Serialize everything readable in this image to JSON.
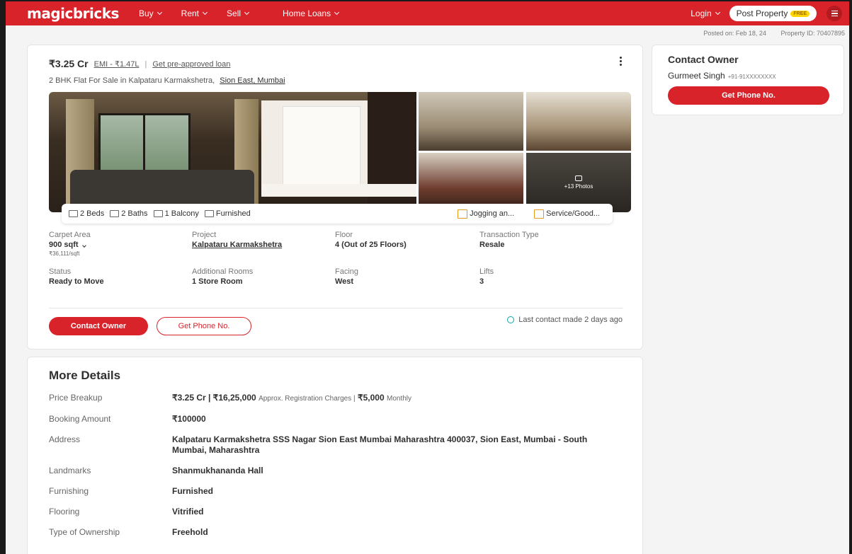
{
  "nav": {
    "logo": "magicbricks",
    "items": [
      "Buy",
      "Rent",
      "Sell",
      "Home Loans"
    ],
    "login": "Login",
    "post_property": "Post Property",
    "free_badge": "FREE"
  },
  "meta": {
    "posted_on": "Posted on: Feb 18, 24",
    "property_id": "Property ID: 70407895"
  },
  "listing": {
    "price": "₹3.25 Cr",
    "emi": "EMI - ₹1.47L",
    "separator": "|",
    "loan_link": "Get pre-approved loan",
    "subtitle": "2 BHK Flat For Sale in Kalpataru Karmakshetra,",
    "location_link": "Sion East, Mumbai",
    "more_photos": "+13 Photos",
    "amenities": [
      {
        "label": "2 Beds",
        "icon": "bed-icon"
      },
      {
        "label": "2 Baths",
        "icon": "bath-icon"
      },
      {
        "label": "1 Balcony",
        "icon": "balcony-icon"
      },
      {
        "label": "Furnished",
        "icon": "furnished-icon"
      }
    ],
    "features": [
      {
        "label": "Jogging an...",
        "icon": "jogging-icon"
      },
      {
        "label": "Service/Good...",
        "icon": "service-lift-icon"
      }
    ],
    "specs": {
      "carpet_area": {
        "label": "Carpet Area",
        "value": "900 sqft",
        "sub": "₹36,111/sqft"
      },
      "project": {
        "label": "Project",
        "value": "Kalpataru Karmakshetra"
      },
      "floor": {
        "label": "Floor",
        "value": "4 (Out of 25 Floors)"
      },
      "transaction": {
        "label": "Transaction Type",
        "value": "Resale"
      },
      "status": {
        "label": "Status",
        "value": "Ready to Move"
      },
      "rooms": {
        "label": "Additional Rooms",
        "value": "1 Store Room"
      },
      "facing": {
        "label": "Facing",
        "value": "West"
      },
      "lifts": {
        "label": "Lifts",
        "value": "3"
      }
    },
    "contact_owner_button": "Contact Owner",
    "get_phone_button": "Get Phone No.",
    "last_contact": "Last contact made 2 days ago"
  },
  "owner": {
    "title": "Contact Owner",
    "name": "Gurmeet Singh",
    "phone": "+91-91XXXXXXXX",
    "button": "Get Phone No."
  },
  "more_details": {
    "title": "More Details",
    "price_breakup": {
      "label": "Price Breakup",
      "main": "₹3.25 Cr | ₹16,25,000",
      "note1": "Approx. Registration Charges |",
      "monthly": "₹5,000",
      "note2": "Monthly"
    },
    "rows": [
      {
        "label": "Booking Amount",
        "value": "₹100000"
      },
      {
        "label": "Address",
        "value": "Kalpataru Karmakshetra SSS Nagar Sion East Mumbai Maharashtra 400037, Sion East, Mumbai - South Mumbai, Maharashtra"
      },
      {
        "label": "Landmarks",
        "value": "Shanmukhananda Hall"
      },
      {
        "label": "Furnishing",
        "value": "Furnished"
      },
      {
        "label": "Flooring",
        "value": "Vitrified"
      },
      {
        "label": "Type of Ownership",
        "value": "Freehold"
      }
    ]
  },
  "colors": {
    "brand": "#d8232a",
    "badge": "#ffd600"
  }
}
